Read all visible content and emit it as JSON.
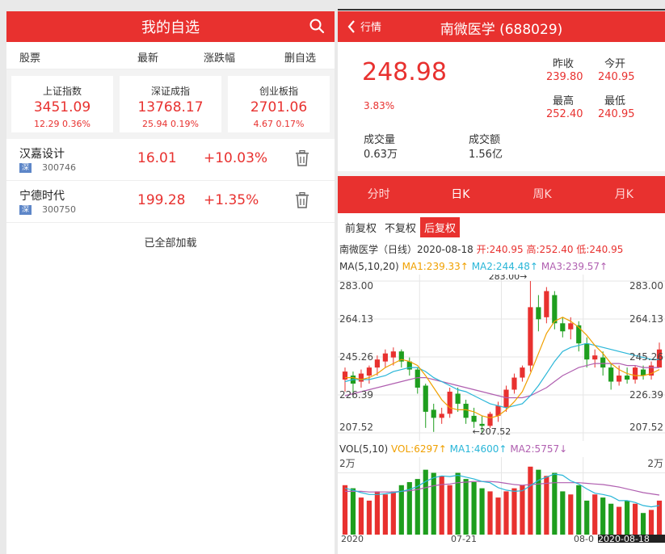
{
  "left": {
    "title": "我的自选",
    "columns": {
      "stock": "股票",
      "latest": "最新",
      "change": "涨跌幅",
      "remove": "删自选"
    },
    "indices": [
      {
        "name": "上证指数",
        "value": "3451.09",
        "change": "12.29 0.36%"
      },
      {
        "name": "深证成指",
        "value": "13768.17",
        "change": "25.94 0.19%"
      },
      {
        "name": "创业板指",
        "value": "2701.06",
        "change": "4.67 0.17%"
      }
    ],
    "stocks": [
      {
        "name": "汉嘉设计",
        "market": "深",
        "code": "300746",
        "price": "16.01",
        "pct": "+10.03%"
      },
      {
        "name": "宁德时代",
        "market": "深",
        "code": "300750",
        "price": "199.28",
        "pct": "+1.35%"
      }
    ],
    "footer": "已全部加载"
  },
  "right": {
    "back_label": "行情",
    "title": "南微医学 (688029)",
    "price": "248.98",
    "pct": "3.83%",
    "prev_close_label": "昨收",
    "prev_close": "239.80",
    "open_label": "今开",
    "open": "240.95",
    "high_label": "最高",
    "high": "252.40",
    "low_label": "最低",
    "low": "240.95",
    "volume_label": "成交量",
    "volume": "0.63万",
    "amount_label": "成交额",
    "amount": "1.56亿",
    "tabs": [
      "分时",
      "日K",
      "周K",
      "月K"
    ],
    "adjust": [
      "前复权",
      "不复权",
      "后复权"
    ],
    "info_name": "南微医学（日线）2020-08-18",
    "info_open": "开:240.95",
    "info_high": "高:252.40",
    "info_low": "低:240.95",
    "ma_label": "MA(5,10,20)",
    "ma1": "MA1:239.33↑",
    "ma2": "MA2:244.48↑",
    "ma3": "MA3:239.57↑",
    "vol_label": "VOL(5,10)",
    "vol": "VOL:6297↑",
    "vma1": "MA1:4600↑",
    "vma2": "MA2:5757↓"
  },
  "colors": {
    "red": "#e8312f",
    "green": "#1e9e1e",
    "ma1": "#f0a000",
    "ma2": "#29b6d8",
    "ma3": "#b05fb0"
  },
  "chart_data": {
    "type": "candlestick",
    "y_ticks": [
      "283.00",
      "264.13",
      "245.26",
      "226.39",
      "207.52"
    ],
    "ylim": [
      207.52,
      283.0
    ],
    "max_label": "283.00→",
    "min_label": "←207.52",
    "vol_tick": "2万",
    "x_ticks": [
      "2020",
      "07-21",
      "08-0",
      "2020-08-18"
    ],
    "candles": [
      [
        234,
        238,
        230,
        228,
        240
      ],
      [
        236,
        232,
        227,
        225,
        238
      ],
      [
        233,
        237,
        231,
        230,
        239
      ],
      [
        236,
        240,
        234,
        232,
        241
      ],
      [
        240,
        244,
        238,
        236,
        246
      ],
      [
        243,
        247,
        241,
        240,
        249
      ],
      [
        245,
        248,
        243,
        241,
        250
      ],
      [
        248,
        243,
        242,
        240,
        249
      ],
      [
        243,
        239,
        238,
        236,
        245
      ],
      [
        239,
        230,
        229,
        227,
        240
      ],
      [
        231,
        218,
        217,
        210,
        232
      ],
      [
        219,
        215,
        214,
        208,
        222
      ],
      [
        215,
        217,
        213,
        212,
        220
      ],
      [
        217,
        228,
        216,
        215,
        230
      ],
      [
        227,
        222,
        220,
        218,
        230
      ],
      [
        222,
        215,
        213,
        212,
        224
      ],
      [
        216,
        213,
        211,
        210,
        220
      ],
      [
        212,
        211,
        208,
        207.5,
        216
      ],
      [
        211,
        217,
        210,
        210,
        218
      ],
      [
        216,
        221,
        214,
        213,
        223
      ],
      [
        220,
        229,
        219,
        218,
        231
      ],
      [
        229,
        235,
        228,
        227,
        237
      ],
      [
        235,
        240,
        234,
        233,
        241
      ],
      [
        241,
        270,
        240,
        238,
        283
      ],
      [
        270,
        264,
        262,
        258,
        276
      ],
      [
        265,
        278,
        264,
        262,
        280
      ],
      [
        276,
        262,
        261,
        259,
        278
      ],
      [
        262,
        258,
        256,
        255,
        265
      ],
      [
        259,
        262,
        255,
        254,
        265
      ],
      [
        261,
        252,
        250,
        248,
        263
      ],
      [
        252,
        244,
        242,
        240,
        255
      ],
      [
        244,
        246,
        241,
        240,
        249
      ],
      [
        245,
        240,
        238,
        236,
        248
      ],
      [
        240,
        233,
        231,
        229,
        242
      ],
      [
        233,
        236,
        232,
        231,
        241
      ],
      [
        236,
        234,
        233,
        232,
        240
      ],
      [
        234,
        240,
        233,
        232,
        241
      ],
      [
        239,
        236,
        235,
        234,
        241
      ],
      [
        236,
        241,
        235,
        234,
        243
      ],
      [
        240,
        248.98,
        240.95,
        240.95,
        252.4
      ]
    ],
    "ma1": [
      235,
      235,
      234,
      235,
      237,
      240,
      242,
      244,
      243,
      241,
      236,
      230,
      224,
      220,
      219,
      219,
      218,
      216,
      215,
      216,
      219,
      223,
      228,
      237,
      247,
      257,
      263,
      265,
      263,
      260,
      256,
      251,
      247,
      242,
      239,
      237,
      236,
      236,
      237,
      239
    ],
    "ma2": [
      233,
      234,
      234,
      234,
      235,
      236,
      238,
      239,
      240,
      240,
      238,
      235,
      233,
      231,
      229,
      228,
      226,
      224,
      222,
      221,
      220,
      221,
      222,
      226,
      231,
      237,
      243,
      248,
      250,
      251,
      252,
      251,
      250,
      249,
      248,
      247,
      246,
      245,
      244,
      244
    ],
    "ma3": [
      226,
      227,
      228,
      229,
      230,
      231,
      232,
      233,
      234,
      235,
      235,
      234,
      233,
      232,
      231,
      230,
      229,
      228,
      227,
      226,
      225,
      225,
      225,
      226,
      228,
      230,
      233,
      236,
      238,
      240,
      241,
      242,
      242,
      242,
      242,
      241,
      241,
      240,
      240,
      240
    ],
    "volumes": [
      0.8,
      0.75,
      0.6,
      0.55,
      0.7,
      0.65,
      0.7,
      0.8,
      0.85,
      0.9,
      1.05,
      1.0,
      0.95,
      0.8,
      1.0,
      0.9,
      0.85,
      0.75,
      0.7,
      0.6,
      0.7,
      0.75,
      0.8,
      1.1,
      1.05,
      0.95,
      1.0,
      0.7,
      0.65,
      0.8,
      0.55,
      0.65,
      0.6,
      0.5,
      0.45,
      0.55,
      0.5,
      0.35,
      0.4,
      0.55
    ],
    "vma1": [
      0.75,
      0.72,
      0.68,
      0.65,
      0.65,
      0.66,
      0.68,
      0.7,
      0.73,
      0.78,
      0.86,
      0.92,
      0.95,
      0.94,
      0.96,
      0.93,
      0.9,
      0.86,
      0.84,
      0.76,
      0.72,
      0.7,
      0.71,
      0.79,
      0.88,
      0.93,
      0.98,
      0.96,
      0.87,
      0.82,
      0.74,
      0.67,
      0.65,
      0.62,
      0.55,
      0.55,
      0.52,
      0.47,
      0.45,
      0.47
    ],
    "vma2": [
      0.7,
      0.7,
      0.7,
      0.69,
      0.69,
      0.69,
      0.69,
      0.7,
      0.71,
      0.73,
      0.76,
      0.79,
      0.81,
      0.82,
      0.84,
      0.85,
      0.86,
      0.86,
      0.86,
      0.85,
      0.83,
      0.81,
      0.8,
      0.81,
      0.82,
      0.83,
      0.84,
      0.84,
      0.84,
      0.84,
      0.83,
      0.82,
      0.81,
      0.79,
      0.77,
      0.74,
      0.71,
      0.68,
      0.66,
      0.64
    ]
  }
}
